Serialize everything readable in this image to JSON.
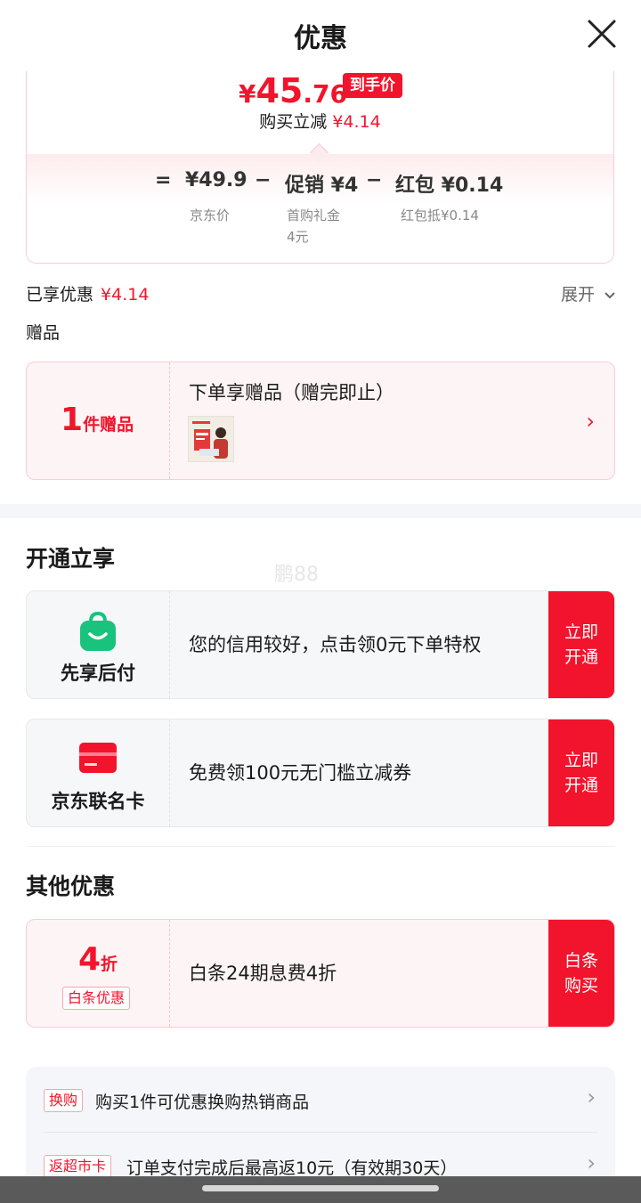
{
  "header": {
    "title": "优惠"
  },
  "price": {
    "symbol": "¥",
    "final_int": "45",
    "final_dec": ".76",
    "final_tag": "到手价",
    "save_label": "购买立减",
    "save_amount": "¥4.14",
    "formula": {
      "equals": "=",
      "base": "¥49.9",
      "base_label": "京东价",
      "minus": "−",
      "promo": "促销 ¥4",
      "promo_label_1": "首购礼金",
      "promo_label_2": "4元",
      "redpack": "红包 ¥0.14",
      "redpack_label": "红包抵¥0.14"
    }
  },
  "enjoyed": {
    "label": "已享优惠",
    "amount": "¥4.14",
    "expand": "展开"
  },
  "gift": {
    "section": "赠品",
    "count": "1",
    "unit": "件赠品",
    "title": "下单享赠品（赠完即止）"
  },
  "open_section": {
    "title": "开通立享"
  },
  "watermark": "鹏88",
  "promos": [
    {
      "name": "先享后付",
      "text": "您的信用较好，点击领0元下单特权",
      "button_1": "立即",
      "button_2": "开通"
    },
    {
      "name": "京东联名卡",
      "text": "免费领100元无门槛立减券",
      "button_1": "立即",
      "button_2": "开通"
    }
  ],
  "other_section": {
    "title": "其他优惠"
  },
  "baitiao": {
    "num": "4",
    "unit": "折",
    "tag": "白条优惠",
    "text": "白条24期息费4折",
    "button_1": "白条",
    "button_2": "购买"
  },
  "list": [
    {
      "tag": "换购",
      "text": "购买1件可优惠换购热销商品"
    },
    {
      "tag": "返超市卡",
      "text": "订单支付完成后最高返10元（有效期30天）"
    }
  ],
  "colors": {
    "accent": "#f2142c",
    "green": "#19c37d"
  }
}
